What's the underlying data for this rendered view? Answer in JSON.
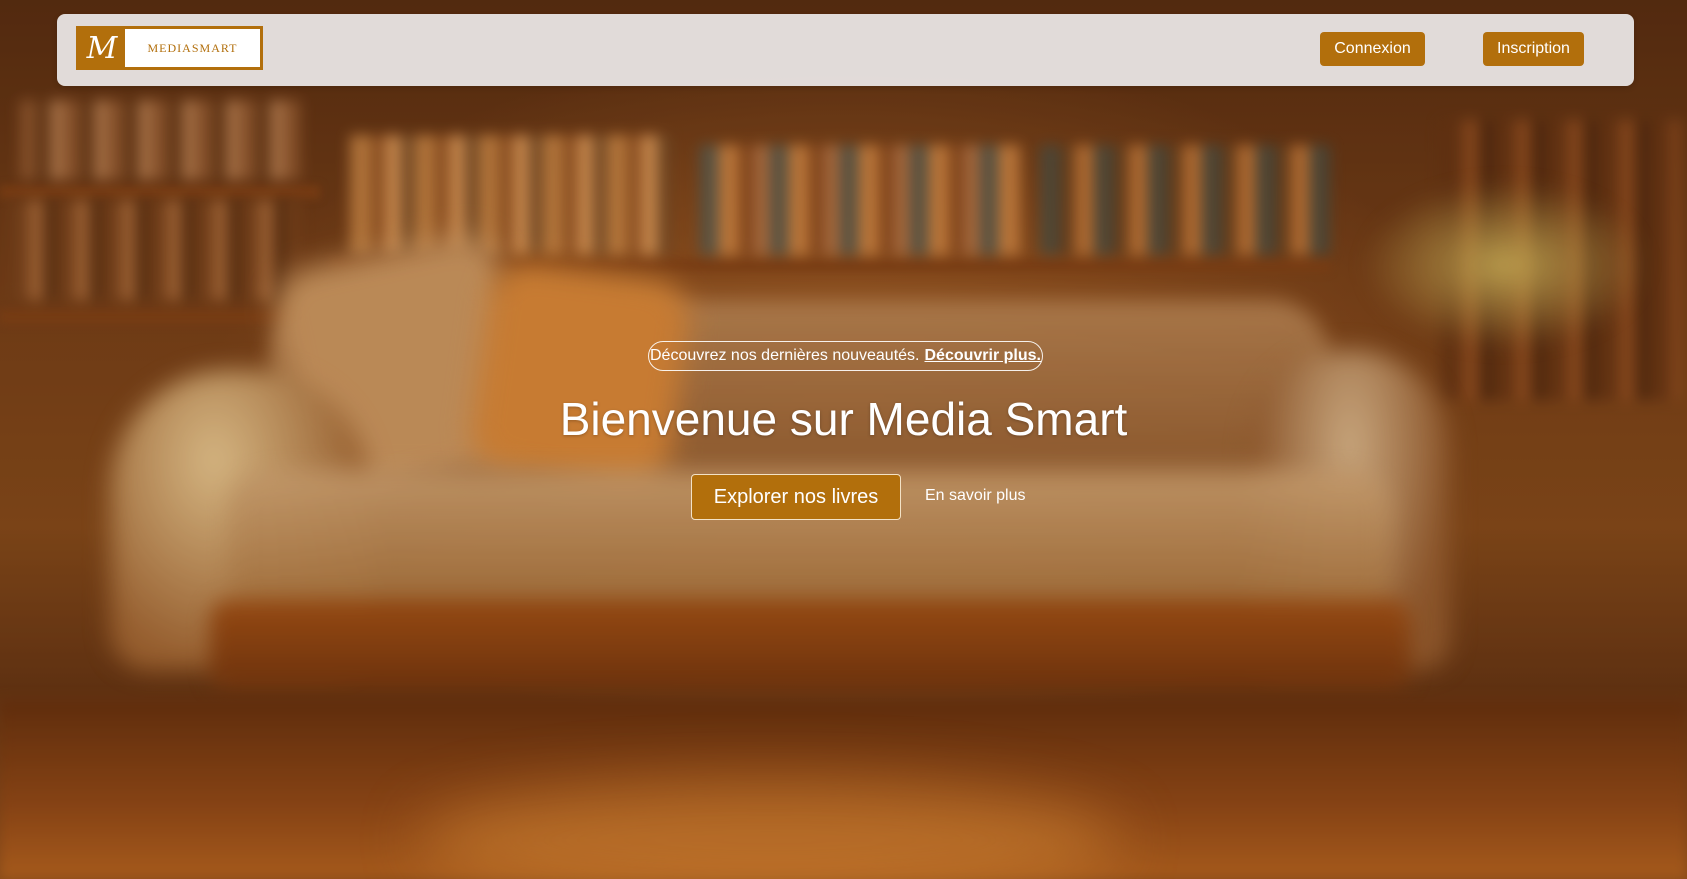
{
  "header": {
    "logo": {
      "mark": "M",
      "brand": "MEDIASMART"
    },
    "login_label": "Connexion",
    "register_label": "Inscription"
  },
  "hero": {
    "announcement": {
      "text": "Découvrez nos dernières nouveautés.",
      "link": "Découvrir plus."
    },
    "title": "Bienvenue sur Media Smart",
    "primary_cta": "Explorer nos livres",
    "secondary_cta": "En savoir plus"
  },
  "colors": {
    "accent": "#b26f0c",
    "header_bg": "#ece8e8",
    "text_light": "#ffffff"
  }
}
